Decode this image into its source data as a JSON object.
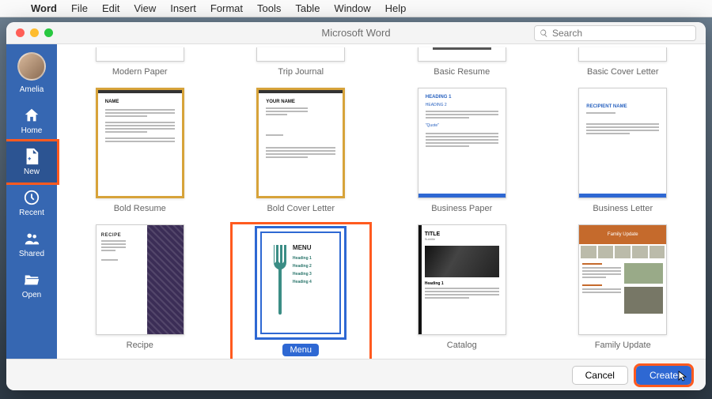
{
  "menubar": {
    "apple": "",
    "app": "Word",
    "items": [
      "File",
      "Edit",
      "View",
      "Insert",
      "Format",
      "Tools",
      "Table",
      "Window",
      "Help"
    ]
  },
  "window": {
    "title": "Microsoft Word",
    "search_placeholder": "Search"
  },
  "sidebar": {
    "username": "Amelia",
    "items": [
      {
        "id": "home",
        "label": "Home"
      },
      {
        "id": "new",
        "label": "New",
        "selected": true,
        "highlight": true
      },
      {
        "id": "recent",
        "label": "Recent"
      },
      {
        "id": "shared",
        "label": "Shared"
      },
      {
        "id": "open",
        "label": "Open"
      }
    ]
  },
  "templates": {
    "row0": [
      {
        "label": "Modern Paper"
      },
      {
        "label": "Trip Journal"
      },
      {
        "label": "Basic Resume"
      },
      {
        "label": "Basic Cover Letter"
      }
    ],
    "row1": [
      {
        "label": "Bold Resume",
        "thumb": {
          "name": "NAME"
        }
      },
      {
        "label": "Bold Cover Letter",
        "thumb": {
          "name": "YOUR NAME"
        }
      },
      {
        "label": "Business Paper",
        "thumb": {
          "h1": "HEADING 1",
          "h2": "HEADING 2",
          "quote": "\"Quote\""
        }
      },
      {
        "label": "Business Letter",
        "thumb": {
          "name": "RECIPIENT NAME"
        }
      }
    ],
    "row2": [
      {
        "label": "Recipe",
        "thumb": {
          "hd": "RECIPE"
        }
      },
      {
        "label": "Menu",
        "selected": true,
        "highlight": true,
        "thumb": {
          "title": "MENU",
          "lines": [
            "Heading 1",
            "Heading 2",
            "Heading 3",
            "Heading 4"
          ]
        }
      },
      {
        "label": "Catalog",
        "thumb": {
          "title": "TITLE",
          "sub": "Subtitle",
          "head": "Heading 1"
        }
      },
      {
        "label": "Family Update",
        "thumb": {
          "hdr": "Family Update"
        }
      }
    ]
  },
  "footer": {
    "cancel": "Cancel",
    "create": "Create",
    "create_highlight": true
  }
}
